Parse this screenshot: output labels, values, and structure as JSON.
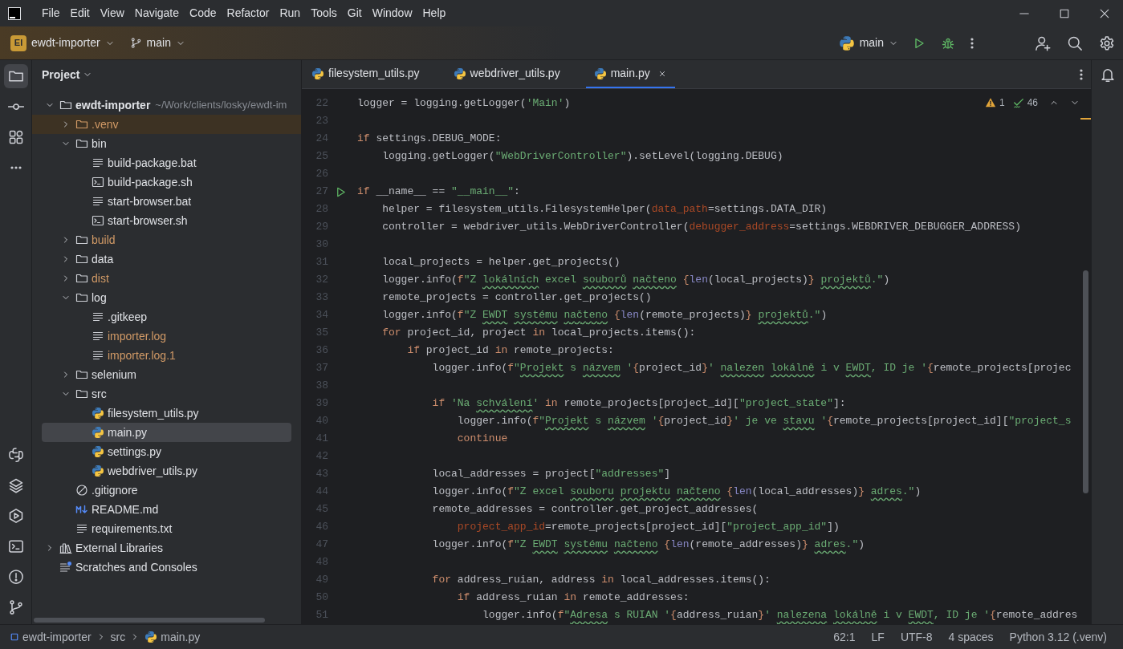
{
  "menu": [
    "File",
    "Edit",
    "View",
    "Navigate",
    "Code",
    "Refactor",
    "Run",
    "Tools",
    "Git",
    "Window",
    "Help"
  ],
  "toolbar": {
    "project_badge": "EI",
    "project": "ewdt-importer",
    "branch": "main",
    "run_config": "main"
  },
  "left_tools": {
    "top": [
      {
        "kind": "project",
        "selected": true
      },
      {
        "kind": "commit",
        "selected": false
      },
      {
        "kind": "structure",
        "selected": false
      },
      {
        "kind": "more",
        "selected": false
      }
    ],
    "bottom": [
      {
        "kind": "python-console",
        "selected": false
      },
      {
        "kind": "layers",
        "selected": false
      },
      {
        "kind": "services",
        "selected": false
      },
      {
        "kind": "terminal",
        "selected": false
      },
      {
        "kind": "problems",
        "selected": false
      },
      {
        "kind": "git",
        "selected": false
      }
    ]
  },
  "project_panel": {
    "title": "Project",
    "tree": [
      {
        "label": "ewdt-importer",
        "path": "~/Work/clients/losky/ewdt-im",
        "kind": "folder",
        "ignored": false,
        "excluded": false,
        "expanded": true,
        "selected": false,
        "children": [
          {
            "label": ".venv",
            "kind": "folder",
            "ignored": true,
            "excluded": true,
            "expanded": false,
            "selected": false
          },
          {
            "label": "bin",
            "kind": "folder",
            "ignored": false,
            "excluded": false,
            "expanded": true,
            "selected": false,
            "children": [
              {
                "label": "build-package.bat",
                "kind": "text",
                "ignored": false,
                "excluded": false,
                "selected": false
              },
              {
                "label": "build-package.sh",
                "kind": "shell",
                "ignored": false,
                "excluded": false,
                "selected": false
              },
              {
                "label": "start-browser.bat",
                "kind": "text",
                "ignored": false,
                "excluded": false,
                "selected": false
              },
              {
                "label": "start-browser.sh",
                "kind": "shell",
                "ignored": false,
                "excluded": false,
                "selected": false
              }
            ]
          },
          {
            "label": "build",
            "kind": "folder",
            "ignored": true,
            "excluded": false,
            "expanded": false,
            "selected": false
          },
          {
            "label": "data",
            "kind": "folder",
            "ignored": false,
            "excluded": false,
            "expanded": false,
            "selected": false
          },
          {
            "label": "dist",
            "kind": "folder",
            "ignored": true,
            "excluded": false,
            "expanded": false,
            "selected": false
          },
          {
            "label": "log",
            "kind": "folder",
            "ignored": false,
            "excluded": false,
            "expanded": true,
            "selected": false,
            "children": [
              {
                "label": ".gitkeep",
                "kind": "text",
                "ignored": false,
                "excluded": false,
                "selected": false
              },
              {
                "label": "importer.log",
                "kind": "text",
                "ignored": true,
                "excluded": false,
                "selected": false
              },
              {
                "label": "importer.log.1",
                "kind": "text",
                "ignored": true,
                "excluded": false,
                "selected": false
              }
            ]
          },
          {
            "label": "selenium",
            "kind": "folder",
            "ignored": false,
            "excluded": false,
            "expanded": false,
            "selected": false
          },
          {
            "label": "src",
            "kind": "folder",
            "ignored": false,
            "excluded": false,
            "expanded": true,
            "selected": false,
            "children": [
              {
                "label": "filesystem_utils.py",
                "kind": "python",
                "ignored": false,
                "excluded": false,
                "selected": false
              },
              {
                "label": "main.py",
                "kind": "python",
                "ignored": false,
                "excluded": false,
                "selected": true
              },
              {
                "label": "settings.py",
                "kind": "python",
                "ignored": false,
                "excluded": false,
                "selected": false
              },
              {
                "label": "webdriver_utils.py",
                "kind": "python",
                "ignored": false,
                "excluded": false,
                "selected": false
              }
            ]
          },
          {
            "label": ".gitignore",
            "kind": "ignore",
            "ignored": false,
            "excluded": false,
            "selected": false
          },
          {
            "label": "README.md",
            "kind": "markdown",
            "ignored": false,
            "excluded": false,
            "selected": false
          },
          {
            "label": "requirements.txt",
            "kind": "text",
            "ignored": false,
            "excluded": false,
            "selected": false
          }
        ]
      },
      {
        "label": "External Libraries",
        "kind": "libraries",
        "ignored": false,
        "excluded": false,
        "expanded": false,
        "selected": false
      },
      {
        "label": "Scratches and Consoles",
        "kind": "scratches",
        "ignored": false,
        "excluded": false,
        "selected": false
      }
    ]
  },
  "editor": {
    "tabs": [
      {
        "label": "filesystem_utils.py",
        "selected": false
      },
      {
        "label": "webdriver_utils.py",
        "selected": false
      },
      {
        "label": "main.py",
        "selected": true
      }
    ],
    "inspections": {
      "warnings": "1",
      "weak_warnings": "46"
    },
    "lines": [
      {
        "number": "22",
        "segments": [
          {
            "kind": "plain",
            "text": "logger = logging.getLogger("
          },
          {
            "kind": "str",
            "text": "'Main'"
          },
          {
            "kind": "plain",
            "text": ")"
          }
        ]
      },
      {
        "number": "23"
      },
      {
        "number": "24",
        "segments": [
          {
            "kind": "kw",
            "text": "if"
          },
          {
            "kind": "plain",
            "text": " settings.DEBUG_MODE:"
          }
        ]
      },
      {
        "number": "25",
        "segments": [
          {
            "kind": "plain",
            "text": "    logging.getLogger("
          },
          {
            "kind": "str",
            "text": "\"WebDriverController\""
          },
          {
            "kind": "plain",
            "text": ").setLevel(logging.DEBUG)"
          }
        ]
      },
      {
        "number": "26"
      },
      {
        "number": "27",
        "kind": "runnable",
        "segments": [
          {
            "kind": "kw",
            "text": "if"
          },
          {
            "kind": "plain",
            "text": " __name__ == "
          },
          {
            "kind": "str",
            "text": "\"__main__\""
          },
          {
            "kind": "plain",
            "text": ":"
          }
        ]
      },
      {
        "number": "28",
        "segments": [
          {
            "kind": "plain",
            "text": "    helper = filesystem_utils.FilesystemHelper("
          },
          {
            "kind": "param",
            "text": "data_path"
          },
          {
            "kind": "plain",
            "text": "=settings.DATA_DIR)"
          }
        ]
      },
      {
        "number": "29",
        "segments": [
          {
            "kind": "plain",
            "text": "    controller = webdriver_utils.WebDriverController("
          },
          {
            "kind": "param",
            "text": "debugger_address"
          },
          {
            "kind": "plain",
            "text": "=settings.WEBDRIVER_DEBUGGER_ADDRESS)"
          }
        ]
      },
      {
        "number": "30"
      },
      {
        "number": "31",
        "segments": [
          {
            "kind": "plain",
            "text": "    local_projects = helper.get_projects()"
          }
        ]
      },
      {
        "number": "32",
        "segments": [
          {
            "kind": "plain",
            "text": "    logger.info("
          },
          {
            "kind": "kw",
            "text": "f"
          },
          {
            "kind": "str",
            "text": "\"Z "
          },
          {
            "kind": "typo",
            "text": "lokálních"
          },
          {
            "kind": "str",
            "text": " excel "
          },
          {
            "kind": "typo",
            "text": "souborů "
          },
          {
            "kind": "typo",
            "text": "načteno "
          },
          {
            "kind": "brace",
            "text": "{"
          },
          {
            "kind": "builtin",
            "text": "len"
          },
          {
            "kind": "plain",
            "text": "(local_projects)"
          },
          {
            "kind": "brace",
            "text": "} "
          },
          {
            "kind": "typo",
            "text": "projektů"
          },
          {
            "kind": "str",
            "text": ".\""
          },
          {
            "kind": "plain",
            "text": ")"
          }
        ]
      },
      {
        "number": "33",
        "segments": [
          {
            "kind": "plain",
            "text": "    remote_projects = controller.get_projects()"
          }
        ]
      },
      {
        "number": "34",
        "segments": [
          {
            "kind": "plain",
            "text": "    logger.info("
          },
          {
            "kind": "kw",
            "text": "f"
          },
          {
            "kind": "str",
            "text": "\"Z "
          },
          {
            "kind": "typo",
            "text": "EWDT "
          },
          {
            "kind": "typo",
            "text": "systému "
          },
          {
            "kind": "typo",
            "text": "načteno "
          },
          {
            "kind": "brace",
            "text": "{"
          },
          {
            "kind": "builtin",
            "text": "len"
          },
          {
            "kind": "plain",
            "text": "(remote_projects)"
          },
          {
            "kind": "brace",
            "text": "} "
          },
          {
            "kind": "typo",
            "text": "projektů"
          },
          {
            "kind": "str",
            "text": ".\""
          },
          {
            "kind": "plain",
            "text": ")"
          }
        ]
      },
      {
        "number": "35",
        "segments": [
          {
            "kind": "kw",
            "text": "    for"
          },
          {
            "kind": "plain",
            "text": " project_id, project "
          },
          {
            "kind": "kw",
            "text": "in"
          },
          {
            "kind": "plain",
            "text": " local_projects.items():"
          }
        ]
      },
      {
        "number": "36",
        "segments": [
          {
            "kind": "kw",
            "text": "        if"
          },
          {
            "kind": "plain",
            "text": " project_id "
          },
          {
            "kind": "kw",
            "text": "in"
          },
          {
            "kind": "plain",
            "text": " remote_projects:"
          }
        ]
      },
      {
        "number": "37",
        "segments": [
          {
            "kind": "plain",
            "text": "            logger.info("
          },
          {
            "kind": "kw",
            "text": "f"
          },
          {
            "kind": "str",
            "text": "\""
          },
          {
            "kind": "typo",
            "text": "Projekt"
          },
          {
            "kind": "str",
            "text": " s "
          },
          {
            "kind": "typo",
            "text": "názvem"
          },
          {
            "kind": "str",
            "text": " '"
          },
          {
            "kind": "brace",
            "text": "{"
          },
          {
            "kind": "plain",
            "text": "project_id"
          },
          {
            "kind": "brace",
            "text": "}"
          },
          {
            "kind": "str",
            "text": "' "
          },
          {
            "kind": "typo",
            "text": "nalezen "
          },
          {
            "kind": "typo",
            "text": "lokálně"
          },
          {
            "kind": "str",
            "text": " i v "
          },
          {
            "kind": "typo",
            "text": "EWDT"
          },
          {
            "kind": "str",
            "text": ", ID je '"
          },
          {
            "kind": "brace",
            "text": "{"
          },
          {
            "kind": "plain",
            "text": "remote_projects[projec"
          }
        ]
      },
      {
        "number": "38"
      },
      {
        "number": "39",
        "segments": [
          {
            "kind": "kw",
            "text": "            if"
          },
          {
            "kind": "str",
            "text": " 'Na "
          },
          {
            "kind": "typo",
            "text": "schválení"
          },
          {
            "kind": "str",
            "text": "'"
          },
          {
            "kind": "kw",
            "text": " in"
          },
          {
            "kind": "plain",
            "text": " remote_projects[project_id]["
          },
          {
            "kind": "str",
            "text": "\"project_state\""
          },
          {
            "kind": "plain",
            "text": "]:"
          }
        ]
      },
      {
        "number": "40",
        "segments": [
          {
            "kind": "plain",
            "text": "                logger.info("
          },
          {
            "kind": "kw",
            "text": "f"
          },
          {
            "kind": "str",
            "text": "\""
          },
          {
            "kind": "typo",
            "text": "Projekt"
          },
          {
            "kind": "str",
            "text": " s "
          },
          {
            "kind": "typo",
            "text": "názvem"
          },
          {
            "kind": "str",
            "text": " '"
          },
          {
            "kind": "brace",
            "text": "{"
          },
          {
            "kind": "plain",
            "text": "project_id"
          },
          {
            "kind": "brace",
            "text": "}"
          },
          {
            "kind": "str",
            "text": "' je ve "
          },
          {
            "kind": "typo",
            "text": "stavu"
          },
          {
            "kind": "str",
            "text": " '"
          },
          {
            "kind": "brace",
            "text": "{"
          },
          {
            "kind": "plain",
            "text": "remote_projects[project_id]["
          },
          {
            "kind": "str",
            "text": "\"project_s"
          }
        ]
      },
      {
        "number": "41",
        "segments": [
          {
            "kind": "kw",
            "text": "                continue"
          }
        ]
      },
      {
        "number": "42"
      },
      {
        "number": "43",
        "segments": [
          {
            "kind": "plain",
            "text": "            local_addresses = project["
          },
          {
            "kind": "str",
            "text": "\"addresses\""
          },
          {
            "kind": "plain",
            "text": "]"
          }
        ]
      },
      {
        "number": "44",
        "segments": [
          {
            "kind": "plain",
            "text": "            logger.info("
          },
          {
            "kind": "kw",
            "text": "f"
          },
          {
            "kind": "str",
            "text": "\"Z excel "
          },
          {
            "kind": "typo",
            "text": "souboru "
          },
          {
            "kind": "typo",
            "text": "projektu "
          },
          {
            "kind": "typo",
            "text": "načteno "
          },
          {
            "kind": "brace",
            "text": "{"
          },
          {
            "kind": "builtin",
            "text": "len"
          },
          {
            "kind": "plain",
            "text": "(local_addresses)"
          },
          {
            "kind": "brace",
            "text": "} "
          },
          {
            "kind": "typo",
            "text": "adres"
          },
          {
            "kind": "str",
            "text": ".\""
          },
          {
            "kind": "plain",
            "text": ")"
          }
        ]
      },
      {
        "number": "45",
        "segments": [
          {
            "kind": "plain",
            "text": "            remote_addresses = controller.get_project_addresses("
          }
        ]
      },
      {
        "number": "46",
        "segments": [
          {
            "kind": "param",
            "text": "                project_app_id"
          },
          {
            "kind": "plain",
            "text": "=remote_projects[project_id]["
          },
          {
            "kind": "str",
            "text": "\"project_app_id\""
          },
          {
            "kind": "plain",
            "text": "])"
          }
        ]
      },
      {
        "number": "47",
        "segments": [
          {
            "kind": "plain",
            "text": "            logger.info("
          },
          {
            "kind": "kw",
            "text": "f"
          },
          {
            "kind": "str",
            "text": "\"Z "
          },
          {
            "kind": "typo",
            "text": "EWDT "
          },
          {
            "kind": "typo",
            "text": "systému "
          },
          {
            "kind": "typo",
            "text": "načteno "
          },
          {
            "kind": "brace",
            "text": "{"
          },
          {
            "kind": "builtin",
            "text": "len"
          },
          {
            "kind": "plain",
            "text": "(remote_addresses)"
          },
          {
            "kind": "brace",
            "text": "} "
          },
          {
            "kind": "typo",
            "text": "adres"
          },
          {
            "kind": "str",
            "text": ".\""
          },
          {
            "kind": "plain",
            "text": ")"
          }
        ]
      },
      {
        "number": "48"
      },
      {
        "number": "49",
        "segments": [
          {
            "kind": "kw",
            "text": "            for"
          },
          {
            "kind": "plain",
            "text": " address_ruian, address "
          },
          {
            "kind": "kw",
            "text": "in"
          },
          {
            "kind": "plain",
            "text": " local_addresses.items():"
          }
        ]
      },
      {
        "number": "50",
        "segments": [
          {
            "kind": "kw",
            "text": "                if"
          },
          {
            "kind": "plain",
            "text": " address_ruian "
          },
          {
            "kind": "kw",
            "text": "in"
          },
          {
            "kind": "plain",
            "text": " remote_addresses:"
          }
        ]
      },
      {
        "number": "51",
        "segments": [
          {
            "kind": "plain",
            "text": "                    logger.info("
          },
          {
            "kind": "kw",
            "text": "f"
          },
          {
            "kind": "str",
            "text": "\""
          },
          {
            "kind": "typo",
            "text": "Adresa"
          },
          {
            "kind": "str",
            "text": " s RUIAN '"
          },
          {
            "kind": "brace",
            "text": "{"
          },
          {
            "kind": "plain",
            "text": "address_ruian"
          },
          {
            "kind": "brace",
            "text": "}"
          },
          {
            "kind": "str",
            "text": "' "
          },
          {
            "kind": "typo",
            "text": "nalezena "
          },
          {
            "kind": "typo",
            "text": "lokálně"
          },
          {
            "kind": "str",
            "text": " i v "
          },
          {
            "kind": "typo",
            "text": "EWDT"
          },
          {
            "kind": "str",
            "text": ", ID je '"
          },
          {
            "kind": "brace",
            "text": "{"
          },
          {
            "kind": "plain",
            "text": "remote_addres"
          }
        ]
      }
    ]
  },
  "status_bar": {
    "breadcrumbs": [
      {
        "label": "ewdt-importer",
        "kind": "module"
      },
      {
        "label": "src",
        "kind": "folder"
      },
      {
        "label": "main.py",
        "kind": "python"
      }
    ],
    "items": [
      "62:1",
      "LF",
      "UTF-8",
      "4 spaces",
      "Python 3.12 (.venv)"
    ]
  }
}
